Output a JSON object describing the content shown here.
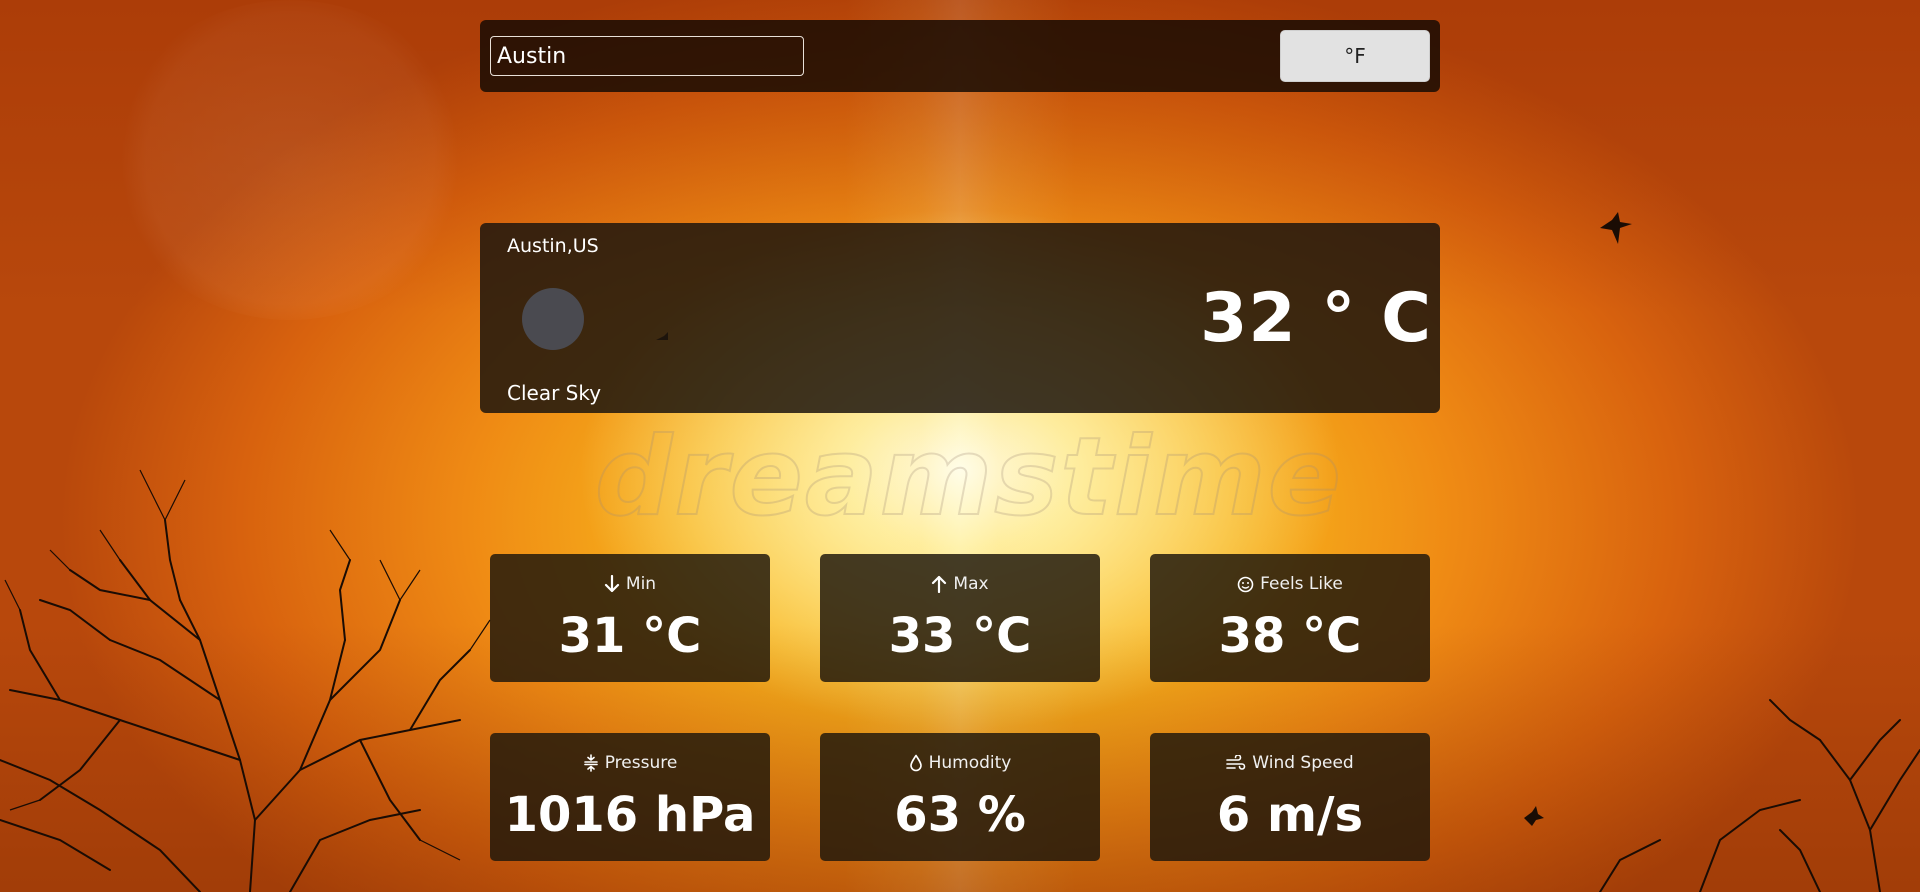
{
  "search": {
    "value": "Austin"
  },
  "unit_toggle": {
    "label": "°F"
  },
  "current": {
    "location": "Austin,US",
    "condition": "Clear Sky",
    "temperature": "32 ° C",
    "icon": "weather-condition-icon"
  },
  "watermark": "dreamstime",
  "stats": {
    "min": {
      "label": "Min",
      "value": "31 °C",
      "icon": "arrow-down-icon"
    },
    "max": {
      "label": "Max",
      "value": "33 °C",
      "icon": "arrow-up-icon"
    },
    "feels_like": {
      "label": "Feels Like",
      "value": "38 °C",
      "icon": "smiley-icon"
    },
    "pressure": {
      "label": "Pressure",
      "value": "1016 hPa",
      "icon": "pressure-icon"
    },
    "humidity": {
      "label": "Humodity",
      "value": "63 %",
      "icon": "droplet-icon"
    },
    "wind": {
      "label": "Wind Speed",
      "value": "6 m/s",
      "icon": "wind-icon"
    }
  }
}
